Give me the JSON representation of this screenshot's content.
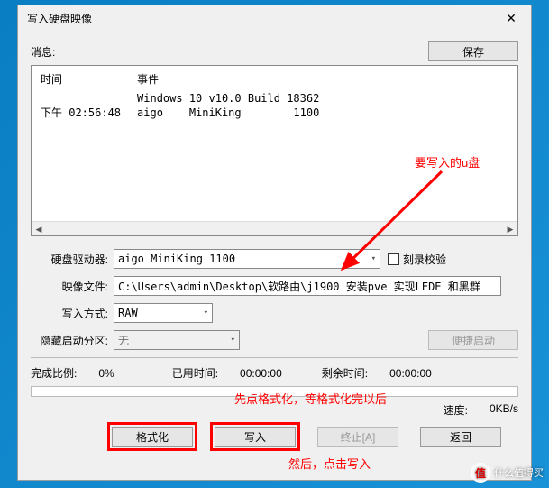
{
  "window": {
    "title": "写入硬盘映像"
  },
  "header": {
    "message_label": "消息:",
    "save_btn": "保存"
  },
  "log": {
    "col_time": "时间",
    "col_event": "事件",
    "rows": [
      {
        "time": "",
        "event": "Windows 10 v10.0 Build 18362"
      },
      {
        "time": "下午 02:56:48",
        "event": "aigo    MiniKing        1100"
      }
    ]
  },
  "form": {
    "drive_label": "硬盘驱动器:",
    "drive_value": "aigo    MiniKing        1100",
    "verify_label": "刻录校验",
    "image_label": "映像文件:",
    "image_value": "C:\\Users\\admin\\Desktop\\软路由\\j1900 安装pve 实现LEDE 和黑群",
    "method_label": "写入方式:",
    "method_value": "RAW",
    "hidden_label": "隐藏启动分区:",
    "hidden_value": "无",
    "quick_btn": "便捷启动"
  },
  "progress": {
    "percent_label": "完成比例:",
    "percent_value": "0%",
    "elapsed_label": "已用时间:",
    "elapsed_value": "00:00:00",
    "remain_label": "剩余时间:",
    "remain_value": "00:00:00",
    "speed_label": "速度:",
    "speed_value": "0KB/s"
  },
  "actions": {
    "format": "格式化",
    "write": "写入",
    "abort": "终止[A]",
    "back": "返回"
  },
  "annotations": {
    "top": "要写入的u盘",
    "mid": "先点格式化，等格式化完以后",
    "bottom": "然后，点击写入"
  },
  "watermark": {
    "badge": "值",
    "text": "什么值得买"
  }
}
